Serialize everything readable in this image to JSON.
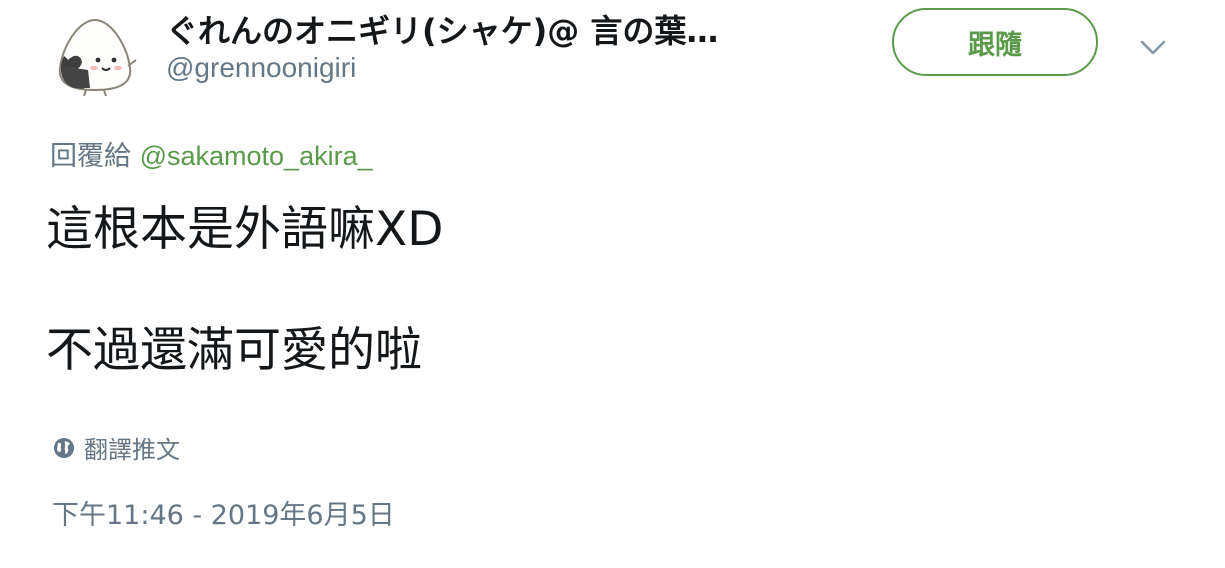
{
  "user": {
    "display_name": "ぐれんのオニギリ(シャケ)@ 言の葉…",
    "handle": "@grennoonigiri"
  },
  "follow_button": {
    "label": "跟隨"
  },
  "icons": {
    "avatar": "onigiri-avatar",
    "menu": "chevron-down-icon",
    "translate": "globe-icon"
  },
  "colors": {
    "accent": "#5a9a4a",
    "secondary_text": "#657786",
    "primary_text": "#14171a"
  },
  "reply": {
    "prefix": "回覆給",
    "mention": "@sakamoto_akira_"
  },
  "tweet": {
    "lines": [
      "這根本是外語嘛XD",
      "不過還滿可愛的啦"
    ]
  },
  "translate": {
    "label": "翻譯推文"
  },
  "timestamp": "下午11:46 - 2019年6月5日"
}
